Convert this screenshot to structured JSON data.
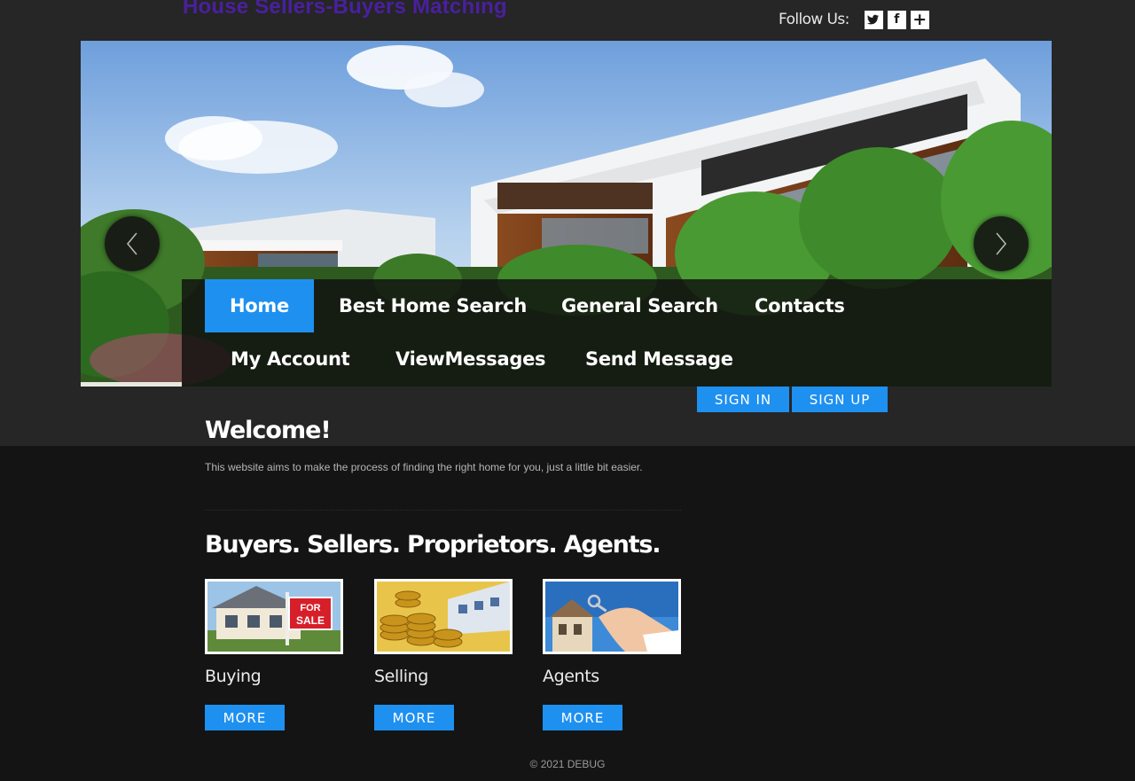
{
  "header": {
    "site_title": "House Sellers-Buyers Matching",
    "follow_label": "Follow Us:",
    "social": [
      {
        "icon": "twitter-icon",
        "glyph": "🐦"
      },
      {
        "icon": "facebook-icon",
        "glyph": "f"
      },
      {
        "icon": "plus-icon",
        "glyph": "+"
      }
    ]
  },
  "nav": {
    "items": [
      "Home",
      "Best Home Search",
      "General Search",
      "Contacts",
      "My Account",
      "ViewMessages",
      "Send Message"
    ],
    "active": "Home",
    "accent": "#1e90f0"
  },
  "auth": {
    "sign_in": "SIGN IN",
    "sign_up": "SIGN UP"
  },
  "main": {
    "welcome_title": "Welcome!",
    "intro": "This website aims to make the process of finding the right home for you, just a little bit easier.",
    "section_title": "Buyers. Sellers. Proprietors. Agents.",
    "cards": [
      {
        "label": "Buying",
        "button": "MORE",
        "image": "house-for-sale-image"
      },
      {
        "label": "Selling",
        "button": "MORE",
        "image": "gold-coins-image"
      },
      {
        "label": "Agents",
        "button": "MORE",
        "image": "hand-holding-key-image"
      }
    ]
  },
  "footer": {
    "copyright": "© 2021 DEBUG"
  }
}
